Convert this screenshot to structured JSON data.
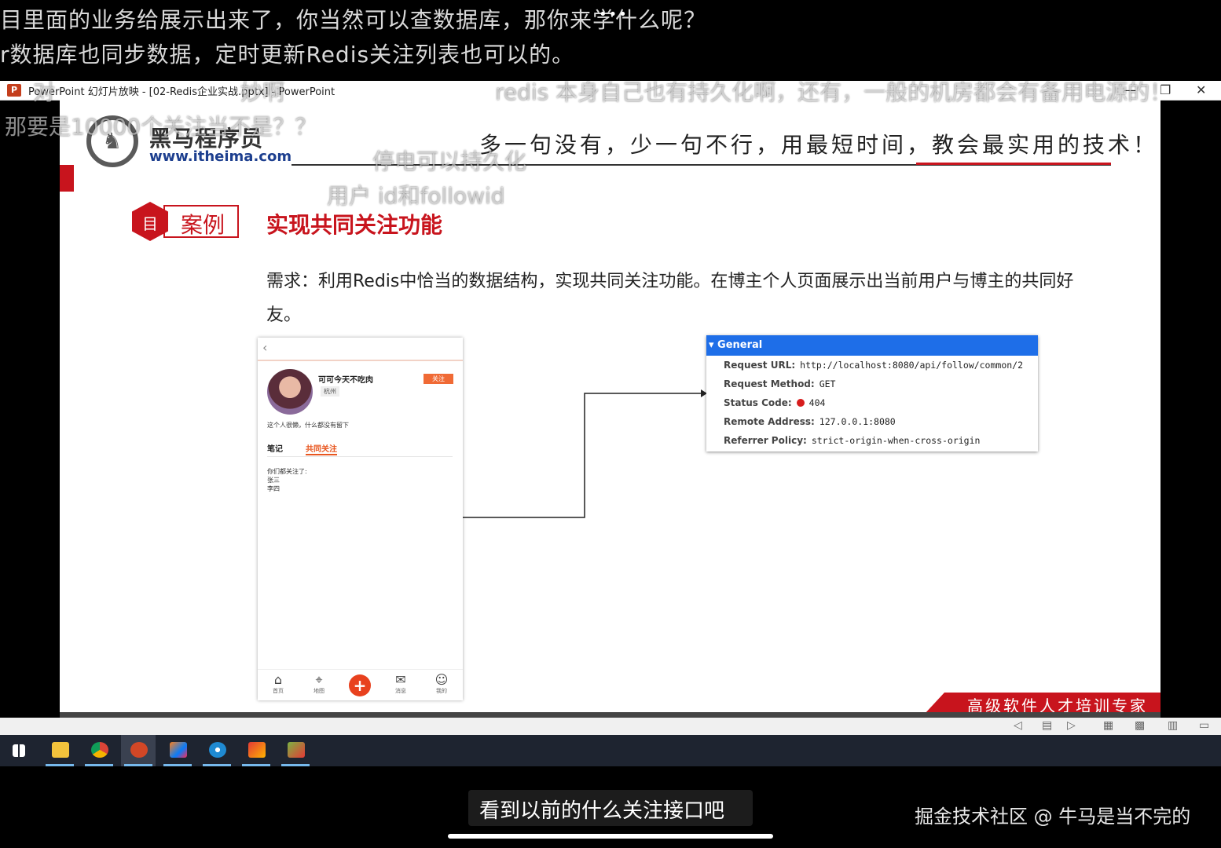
{
  "overlay": {
    "top_line1": "目里面的业务给展示出来了，你当然可以查数据库，那你来学什么呢？",
    "top_line2": "r数据库也同步数据，定时更新Redis关注列表也可以的。",
    "danmaku": [
      "对",
      "妙啊",
      "redis 本身自己也有持久化啊，还有，一般的机房都会有备用电源的！",
      "那要是10000个关注当不是？？",
      "停电可以持久化",
      "用户 id和followid"
    ],
    "more_dots": "•••"
  },
  "window": {
    "title": "PowerPoint 幻灯片放映 - [02-Redis企业实战.pptx] - PowerPoint",
    "app_icon_letter": "P",
    "minimize": "—",
    "restore": "❐",
    "close": "✕"
  },
  "slide": {
    "logo_cn": "黑马程序员",
    "logo_url": "www.itheima.com",
    "slogan": "多一句没有，少一句不行，用最短时间，教会最实用的技术！",
    "case_label": "案例",
    "heading": "实现共同关注功能",
    "requirement": "需求：利用Redis中恰当的数据结构，实现共同关注功能。在博主个人页面展示出当前用户与博主的共同好友。",
    "footer": "高级软件人才培训专家",
    "phone": {
      "back": "‹",
      "name": "可可今天不吃肉",
      "city": "杭州",
      "follow": "关注",
      "desc": "这个人很懒，什么都没有留下",
      "tab_notes": "笔记",
      "tab_common": "共同关注",
      "list_title": "你们都关注了:",
      "list_items": [
        "张三",
        "李四"
      ],
      "nav": [
        {
          "icon": "⌂",
          "label": "首页"
        },
        {
          "icon": "⌖",
          "label": "地图"
        },
        {
          "icon": "+",
          "label": ""
        },
        {
          "icon": "✉",
          "label": "消息"
        },
        {
          "icon": "☺",
          "label": "我的"
        }
      ]
    },
    "devtools": {
      "section": "▾ General",
      "rows": [
        {
          "key": "Request URL:",
          "value": "http://localhost:8080/api/follow/common/2"
        },
        {
          "key": "Request Method:",
          "value": "GET"
        },
        {
          "key": "Status Code:",
          "value": "404"
        },
        {
          "key": "Remote Address:",
          "value": "127.0.0.1:8080"
        },
        {
          "key": "Referrer Policy:",
          "value": "strict-origin-when-cross-origin"
        }
      ]
    }
  },
  "bottom": {
    "subtitle": "看到以前的什么关注接口吧",
    "watermark": "掘金技术社区 @ 牛马是当不完的"
  },
  "taskbar": {
    "icons": [
      "windows-start",
      "file-explorer",
      "chrome",
      "powerpoint",
      "intellij",
      "app-blue",
      "app-red",
      "app-tools"
    ]
  },
  "colors": {
    "brand_red": "#c8141d",
    "devtools_blue": "#1e6ee8",
    "phone_orange": "#e8561f"
  }
}
